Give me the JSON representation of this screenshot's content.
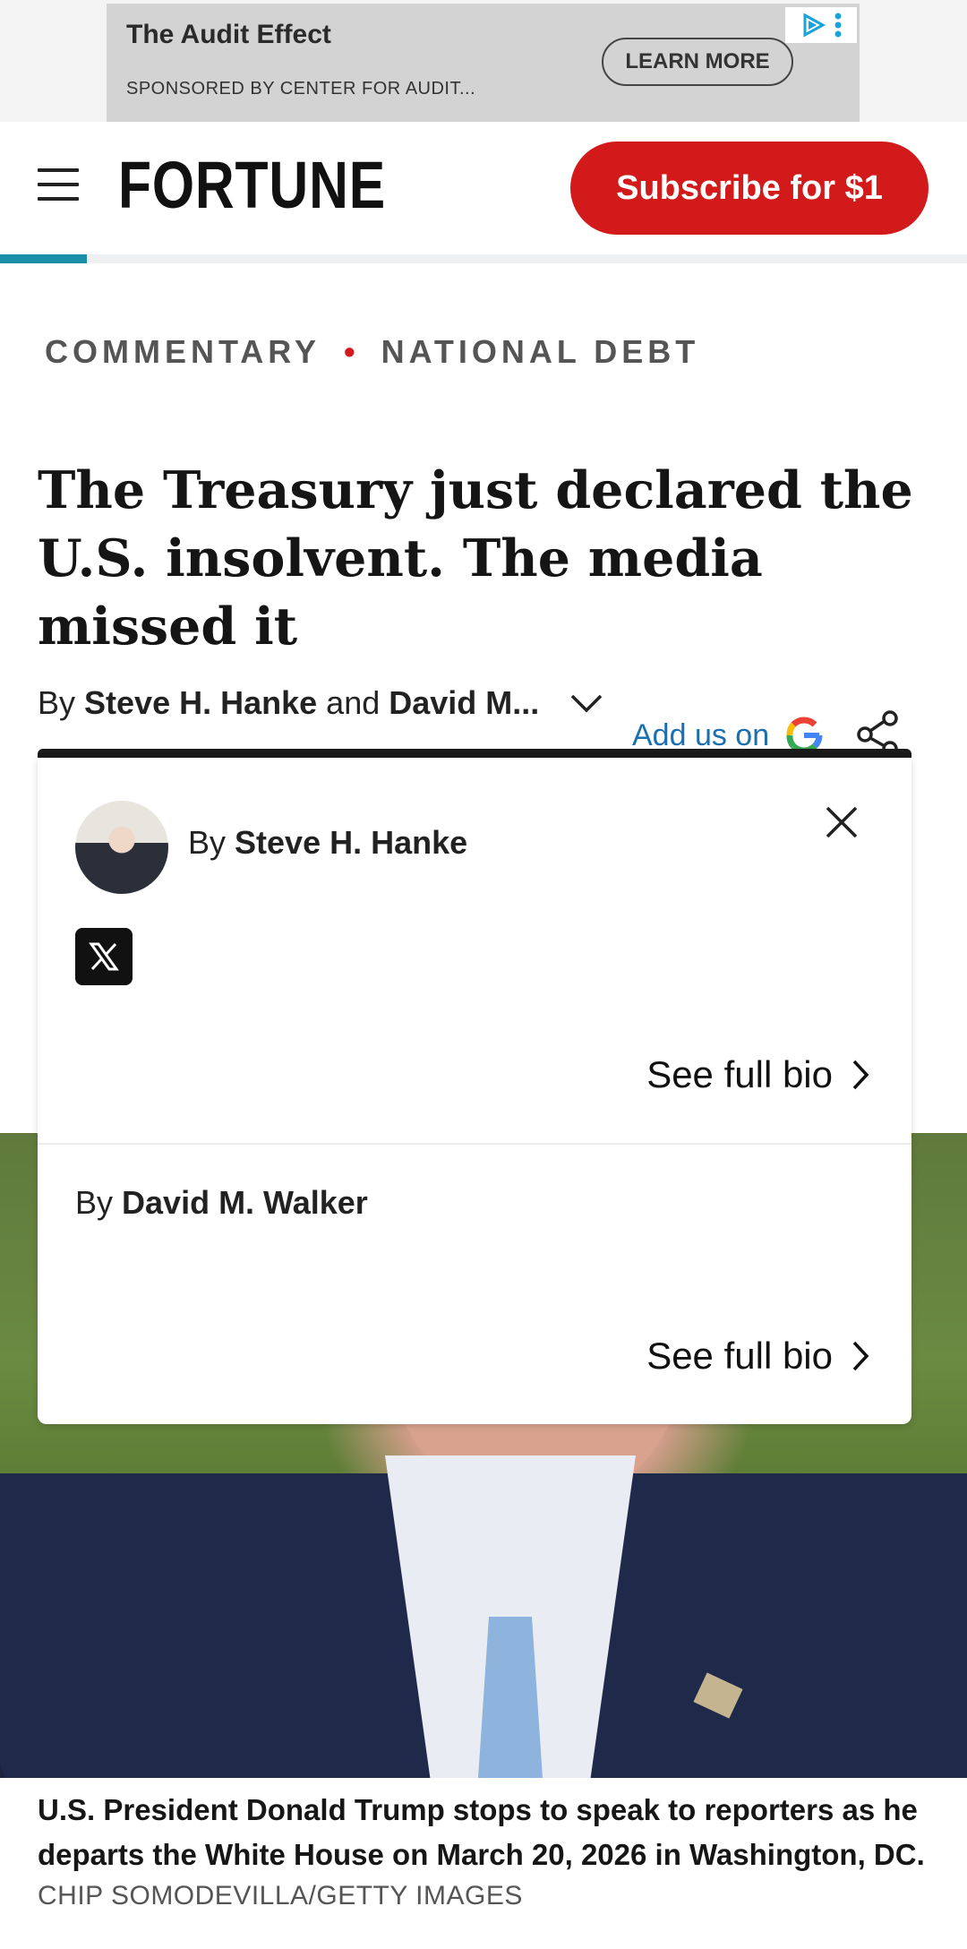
{
  "ad": {
    "title": "The Audit Effect",
    "sponsor": "SPONSORED BY CENTER FOR AUDIT...",
    "cta": "LEARN MORE"
  },
  "header": {
    "logo": "FORTUNE",
    "subscribe": "Subscribe for $1",
    "reading_progress": 0.09
  },
  "article": {
    "section": "COMMENTARY",
    "topic": "NATIONAL DEBT",
    "headline": "The Treasury just declared the U.S. insolvent. The media missed it",
    "byline_prefix": "By",
    "author_1_short": "Steve H. Hanke",
    "byline_and": "and",
    "author_2_short": "David M...",
    "add_us": "Add us on"
  },
  "popup": {
    "by": "By",
    "author_1": "Steve H. Hanke",
    "author_2": "David M. Walker",
    "see_bio": "See full bio"
  },
  "photo": {
    "caption": "U.S. President Donald Trump stops to speak to reporters as he departs the White House on March 20, 2026 in Washington, DC.",
    "credit": "CHIP SOMODEVILLA/GETTY IMAGES"
  },
  "colors": {
    "brand_red": "#d21a1a",
    "progress_teal": "#1d8ea8",
    "link_blue": "#1a6fb0"
  }
}
